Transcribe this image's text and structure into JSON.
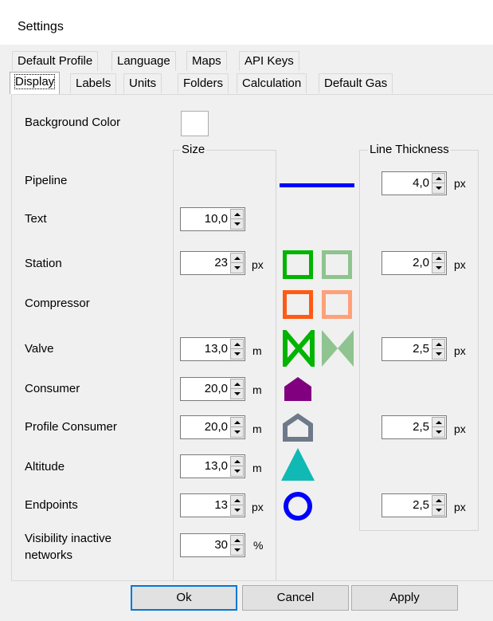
{
  "window": {
    "title": "Settings"
  },
  "tabs_row1": [
    "Default Profile",
    "Language",
    "Maps",
    "API Keys"
  ],
  "tabs_row2": [
    "Display",
    "Labels",
    "Units",
    "Folders",
    "Calculation",
    "Default Gas"
  ],
  "display": {
    "background_color_label": "Background Color",
    "size_group_label": "Size",
    "line_thickness_group_label": "Line Thickness",
    "rows": {
      "pipeline": {
        "label": "Pipeline",
        "thickness": "4,0",
        "thickness_unit": "px",
        "color": "#0000ff"
      },
      "text": {
        "label": "Text",
        "size": "10,0"
      },
      "station": {
        "label": "Station",
        "size": "23",
        "size_unit": "px",
        "thickness": "2,0",
        "thickness_unit": "px",
        "color": "#00b400",
        "inactive_color": "#8fc38f"
      },
      "compressor": {
        "label": "Compressor",
        "color": "#ff5a14",
        "inactive_color": "#ffa078"
      },
      "valve": {
        "label": "Valve",
        "size": "13,0",
        "size_unit": "m",
        "thickness": "2,5",
        "thickness_unit": "px",
        "color": "#00b400",
        "inactive_color": "#8fc38f"
      },
      "consumer": {
        "label": "Consumer",
        "size": "20,0",
        "size_unit": "m",
        "color": "#800080"
      },
      "profile_consumer": {
        "label": "Profile Consumer",
        "size": "20,0",
        "size_unit": "m",
        "thickness": "2,5",
        "thickness_unit": "px",
        "color": "#6e7a8a"
      },
      "altitude": {
        "label": "Altitude",
        "size": "13,0",
        "size_unit": "m",
        "color": "#10b9b4"
      },
      "endpoints": {
        "label": "Endpoints",
        "size": "13",
        "size_unit": "px",
        "thickness": "2,5",
        "thickness_unit": "px",
        "color": "#0000ff"
      },
      "visibility": {
        "label_line1": "Visibility inactive",
        "label_line2": "networks",
        "size": "30",
        "size_unit": "%"
      }
    }
  },
  "buttons": {
    "ok": "Ok",
    "cancel": "Cancel",
    "apply": "Apply"
  }
}
